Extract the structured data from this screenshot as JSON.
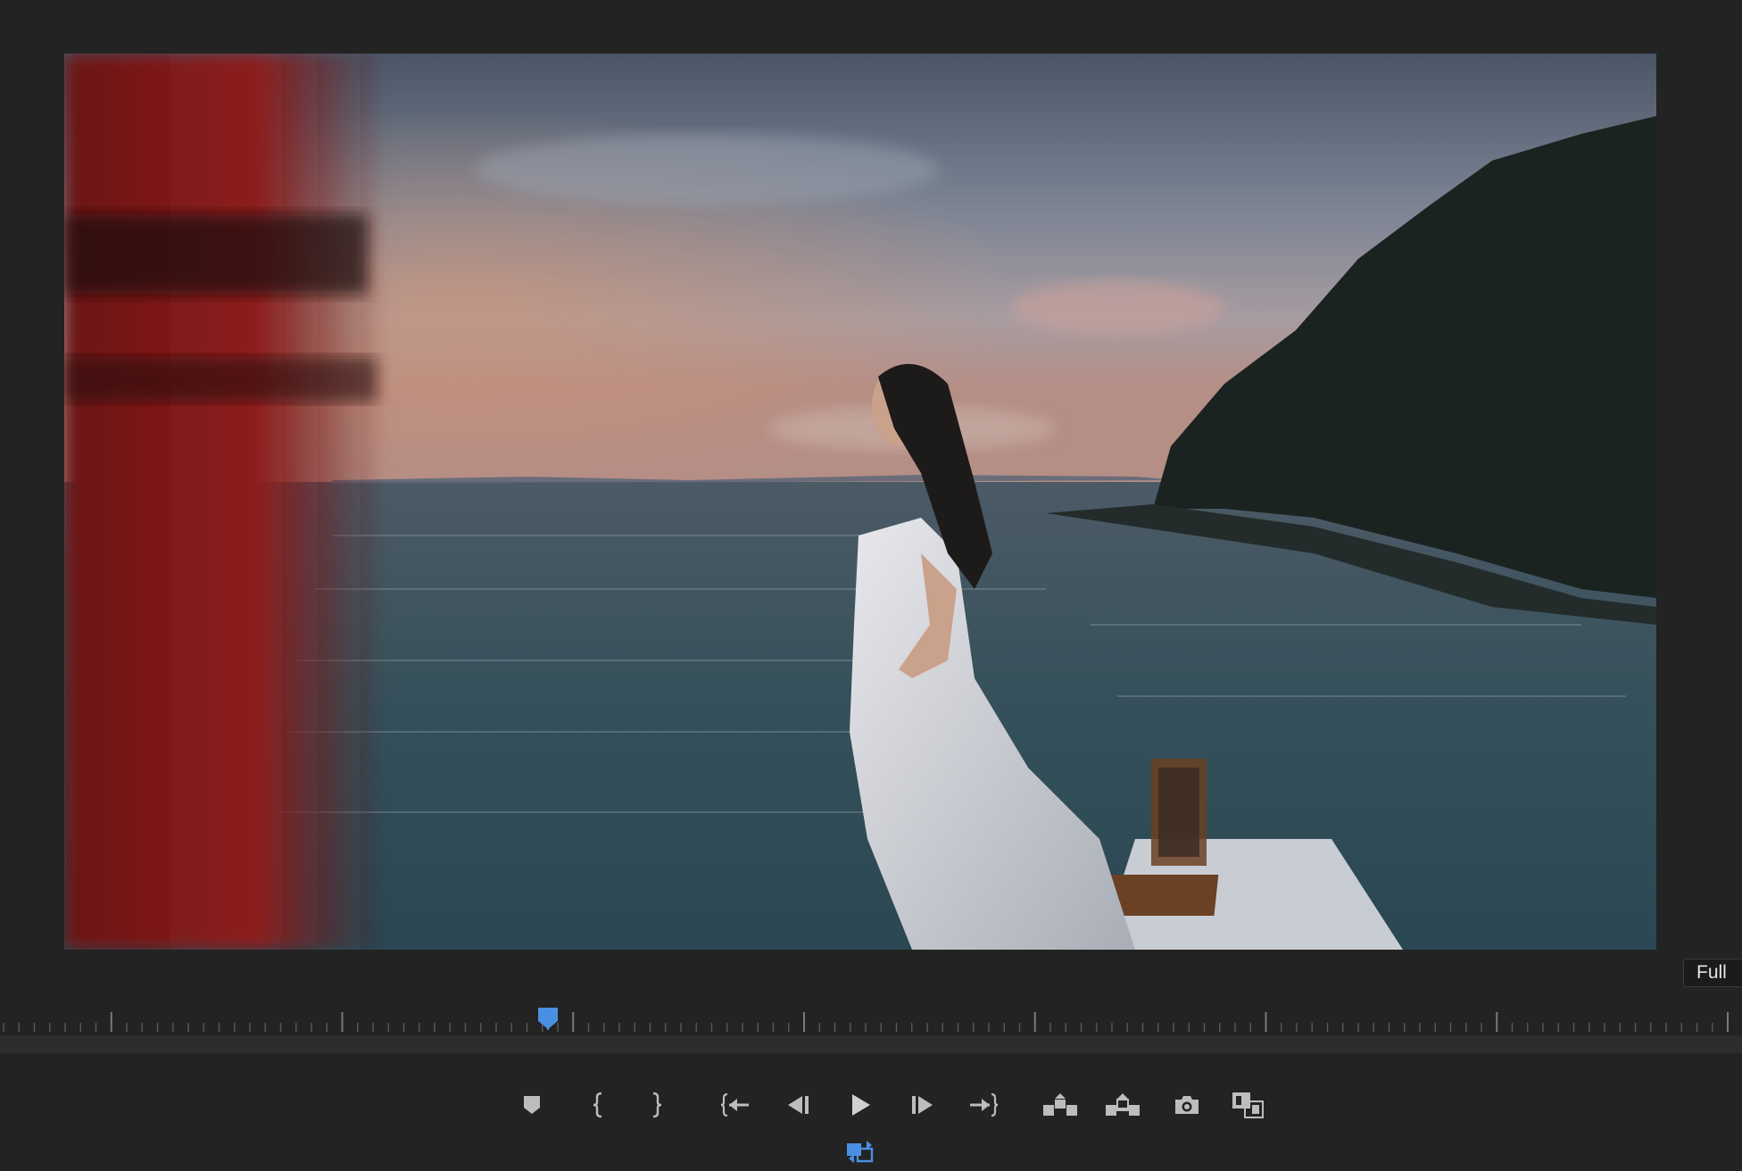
{
  "monitor": {
    "zoom_level": "Full",
    "accent_color": "#4a90e2",
    "icon_color": "#bdbdbd"
  },
  "transport": {
    "buttons": [
      {
        "name": "add-marker-button",
        "icon": "marker-icon"
      },
      {
        "name": "mark-in-button",
        "icon": "mark-in-icon"
      },
      {
        "name": "mark-out-button",
        "icon": "mark-out-icon"
      },
      {
        "name": "go-to-in-button",
        "icon": "go-to-in-icon"
      },
      {
        "name": "step-back-button",
        "icon": "step-back-icon"
      },
      {
        "name": "play-button",
        "icon": "play-icon"
      },
      {
        "name": "step-forward-button",
        "icon": "step-forward-icon"
      },
      {
        "name": "go-to-out-button",
        "icon": "go-to-out-icon"
      },
      {
        "name": "lift-button",
        "icon": "lift-icon"
      },
      {
        "name": "extract-button",
        "icon": "extract-icon"
      },
      {
        "name": "export-frame-button",
        "icon": "camera-icon"
      },
      {
        "name": "comparison-view-button",
        "icon": "comparison-view-icon"
      },
      {
        "name": "loop-playback-button",
        "icon": "loop-icon"
      }
    ]
  }
}
